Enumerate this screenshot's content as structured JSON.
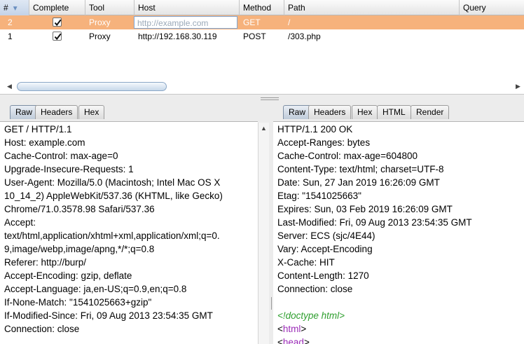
{
  "history": {
    "columns": [
      "#",
      "Complete",
      "Tool",
      "Host",
      "Method",
      "Path",
      "Query"
    ],
    "sort_indicator": "▼",
    "rows": [
      {
        "num": "2",
        "complete": true,
        "tool": "Proxy",
        "host": "http://example.com",
        "method": "GET",
        "path": "/",
        "query": ""
      },
      {
        "num": "1",
        "complete": true,
        "tool": "Proxy",
        "host": "http://192.168.30.119",
        "method": "POST",
        "path": "/303.php",
        "query": ""
      }
    ]
  },
  "request_tabs": [
    "Raw",
    "Headers",
    "Hex"
  ],
  "response_tabs": [
    "Raw",
    "Headers",
    "Hex",
    "HTML",
    "Render"
  ],
  "request_lines": [
    "GET / HTTP/1.1",
    "Host: example.com",
    "Cache-Control: max-age=0",
    "Upgrade-Insecure-Requests: 1",
    "User-Agent: Mozilla/5.0 (Macintosh; Intel Mac OS X",
    "10_14_2) AppleWebKit/537.36 (KHTML, like Gecko)",
    "Chrome/71.0.3578.98 Safari/537.36",
    "Accept:",
    "text/html,application/xhtml+xml,application/xml;q=0.",
    "9,image/webp,image/apng,*/*;q=0.8",
    "Referer: http://burp/",
    "Accept-Encoding: gzip, deflate",
    "Accept-Language: ja,en-US;q=0.9,en;q=0.8",
    "If-None-Match: \"1541025663+gzip\"",
    "If-Modified-Since: Fri, 09 Aug 2013 23:54:35 GMT",
    "Connection: close"
  ],
  "response_lines": [
    "HTTP/1.1 200 OK",
    "Accept-Ranges: bytes",
    "Cache-Control: max-age=604800",
    "Content-Type: text/html; charset=UTF-8",
    "Date: Sun, 27 Jan 2019 16:26:09 GMT",
    "Etag: \"1541025663\"",
    "Expires: Sun, 03 Feb 2019 16:26:09 GMT",
    "Last-Modified: Fri, 09 Aug 2013 23:54:35 GMT",
    "Server: ECS (sjc/4E44)",
    "Vary: Accept-Encoding",
    "X-Cache: HIT",
    "Content-Length: 1270",
    "Connection: close",
    ""
  ],
  "response_html": {
    "doctype": "<!doctype html>",
    "tag1": "html",
    "tag2": "head"
  },
  "colors": {
    "selected_row": "#f6b27c",
    "active_tab": "#bfcbd9",
    "doctype": "#2f9f2f",
    "tag_name": "#9b2bb7"
  }
}
